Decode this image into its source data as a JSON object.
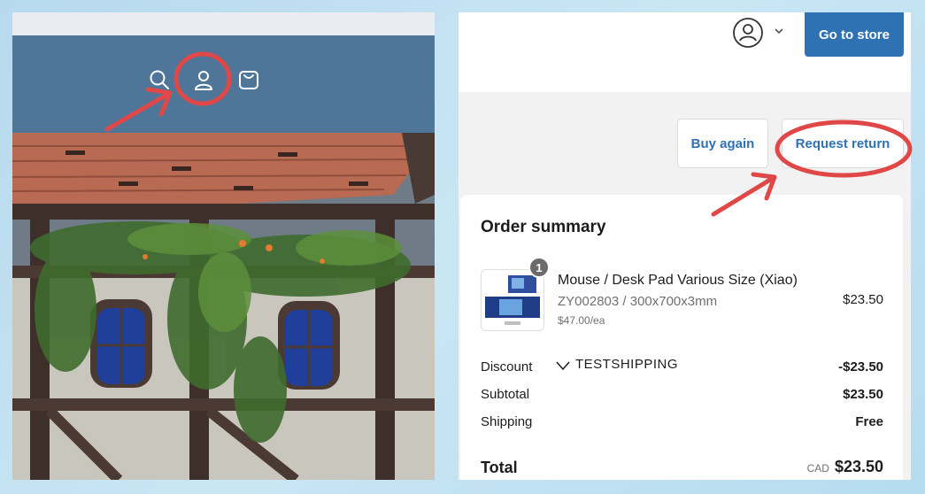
{
  "store_header": {
    "icons": [
      "search-icon",
      "account-icon",
      "shopping-bag-icon"
    ]
  },
  "account_bar": {
    "go_to_store_label": "Go to store",
    "avatar_icon": "user-circle-icon"
  },
  "actions": {
    "buy_again_label": "Buy again",
    "request_return_label": "Request return"
  },
  "order_summary": {
    "title": "Order summary",
    "item": {
      "quantity": "1",
      "name": "Mouse / Desk Pad Various Size (Xiao)",
      "variant": "ZY002803 / 300x700x3mm",
      "unit_price": "$47.00/ea",
      "price": "$23.50"
    },
    "discount": {
      "label": "Discount",
      "code": "TESTSHIPPING",
      "value": "-$23.50"
    },
    "subtotal": {
      "label": "Subtotal",
      "value": "$23.50"
    },
    "shipping": {
      "label": "Shipping",
      "value": "Free"
    },
    "total": {
      "label": "Total",
      "currency": "CAD",
      "value": "$23.50"
    }
  },
  "colors": {
    "accent": "#2f72b3",
    "header_blue": "#4f7698",
    "annotation_red": "#e04848"
  }
}
